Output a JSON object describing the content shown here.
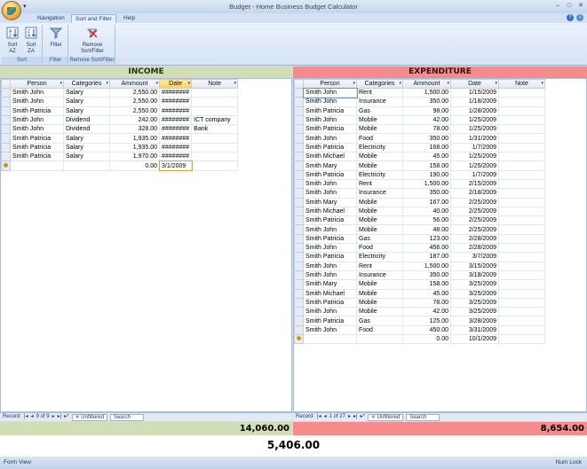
{
  "window": {
    "title": "Budget - Home Business Budget Calculator"
  },
  "ribbon": {
    "tabs": [
      {
        "label": "Navigation"
      },
      {
        "label": "Sort and Filter"
      },
      {
        "label": "Help"
      }
    ],
    "groups": {
      "sort": {
        "label": "Sort",
        "sort_az": "Sort\nAZ",
        "sort_za": "Sort\nZA"
      },
      "filter": {
        "label": "Filter",
        "filter_btn": "Filter"
      },
      "remove": {
        "label": "Remove Sort/Filter",
        "remove_btn": "Remove\nSort/Filter"
      }
    }
  },
  "income": {
    "header": "INCOME",
    "columns": [
      "Person",
      "Categories",
      "Ammount",
      "Date",
      "Note"
    ],
    "rows": [
      {
        "person": "Smith John",
        "category": "Salary",
        "amount": "2,550.00",
        "date": "########",
        "note": ""
      },
      {
        "person": "Smith John",
        "category": "Salary",
        "amount": "2,550.00",
        "date": "########",
        "note": ""
      },
      {
        "person": "Smith Patricia",
        "category": "Salary",
        "amount": "2,550.00",
        "date": "########",
        "note": ""
      },
      {
        "person": "Smith John",
        "category": "Dividend",
        "amount": "242.00",
        "date": "########",
        "note": "ICT company"
      },
      {
        "person": "Smith John",
        "category": "Dividend",
        "amount": "328.00",
        "date": "########",
        "note": "Bank"
      },
      {
        "person": "Smith Patricia",
        "category": "Salary",
        "amount": "1,935.00",
        "date": "########",
        "note": ""
      },
      {
        "person": "Smith Patricia",
        "category": "Salary",
        "amount": "1,935.00",
        "date": "########",
        "note": ""
      },
      {
        "person": "Smith Patricia",
        "category": "Salary",
        "amount": "1,970.00",
        "date": "########",
        "note": ""
      }
    ],
    "new_row": {
      "amount": "0.00",
      "date": "3/1/2009"
    },
    "nav": {
      "record_label": "Record:",
      "position": "9 of 9",
      "filter": "Unfiltered",
      "search": "Search"
    },
    "total": "14,060.00"
  },
  "expenditure": {
    "header": "EXPENDITURE",
    "columns": [
      "Person",
      "Categories",
      "Ammount",
      "Date",
      "Note"
    ],
    "rows": [
      {
        "person": "Smith John",
        "category": "Rent",
        "amount": "1,500.00",
        "date": "1/15/2009",
        "note": ""
      },
      {
        "person": "Smith John",
        "category": "Insurance",
        "amount": "350.00",
        "date": "1/18/2009",
        "note": ""
      },
      {
        "person": "Smith Patricia",
        "category": "Gas",
        "amount": "98.00",
        "date": "1/28/2009",
        "note": ""
      },
      {
        "person": "Smith John",
        "category": "Mobile",
        "amount": "42.00",
        "date": "1/25/2009",
        "note": ""
      },
      {
        "person": "Smith Patricia",
        "category": "Mobile",
        "amount": "78.00",
        "date": "1/25/2009",
        "note": ""
      },
      {
        "person": "Smith John",
        "category": "Food",
        "amount": "350.00",
        "date": "1/31/2009",
        "note": ""
      },
      {
        "person": "Smith Patricia",
        "category": "Electricity",
        "amount": "168.00",
        "date": "1/7/2009",
        "note": ""
      },
      {
        "person": "Smith Michael",
        "category": "Mobile",
        "amount": "45.00",
        "date": "1/25/2009",
        "note": ""
      },
      {
        "person": "Smith Mary",
        "category": "Mobile",
        "amount": "158.00",
        "date": "1/25/2009",
        "note": ""
      },
      {
        "person": "Smith Patricia",
        "category": "Electricity",
        "amount": "190.00",
        "date": "1/7/2009",
        "note": ""
      },
      {
        "person": "Smith John",
        "category": "Rent",
        "amount": "1,500.00",
        "date": "2/15/2009",
        "note": ""
      },
      {
        "person": "Smith John",
        "category": "Insurance",
        "amount": "350.00",
        "date": "2/18/2009",
        "note": ""
      },
      {
        "person": "Smith Mary",
        "category": "Mobile",
        "amount": "167.00",
        "date": "2/25/2009",
        "note": ""
      },
      {
        "person": "Smith Michael",
        "category": "Mobile",
        "amount": "40.00",
        "date": "2/25/2009",
        "note": ""
      },
      {
        "person": "Smith Patricia",
        "category": "Mobile",
        "amount": "56.00",
        "date": "2/25/2009",
        "note": ""
      },
      {
        "person": "Smith John",
        "category": "Mobile",
        "amount": "48.00",
        "date": "2/25/2009",
        "note": ""
      },
      {
        "person": "Smith Patricia",
        "category": "Gas",
        "amount": "123.00",
        "date": "2/28/2009",
        "note": ""
      },
      {
        "person": "Smith John",
        "category": "Food",
        "amount": "456.00",
        "date": "2/28/2009",
        "note": ""
      },
      {
        "person": "Smith Patricia",
        "category": "Electricity",
        "amount": "187.00",
        "date": "3/7/2009",
        "note": ""
      },
      {
        "person": "Smith John",
        "category": "Rent",
        "amount": "1,500.00",
        "date": "3/15/2009",
        "note": ""
      },
      {
        "person": "Smith John",
        "category": "Insurance",
        "amount": "350.00",
        "date": "3/18/2009",
        "note": ""
      },
      {
        "person": "Smith Mary",
        "category": "Mobile",
        "amount": "158.00",
        "date": "3/25/2009",
        "note": ""
      },
      {
        "person": "Smith Michael",
        "category": "Mobile",
        "amount": "45.00",
        "date": "3/25/2009",
        "note": ""
      },
      {
        "person": "Smith Patricia",
        "category": "Mobile",
        "amount": "78.00",
        "date": "3/25/2009",
        "note": ""
      },
      {
        "person": "Smith John",
        "category": "Mobile",
        "amount": "42.00",
        "date": "3/25/2009",
        "note": ""
      },
      {
        "person": "Smith Patricia",
        "category": "Gas",
        "amount": "125.00",
        "date": "3/28/2009",
        "note": ""
      },
      {
        "person": "Smith John",
        "category": "Food",
        "amount": "450.00",
        "date": "3/31/2009",
        "note": ""
      }
    ],
    "new_row": {
      "amount": "0.00",
      "date": "10/1/2009"
    },
    "nav": {
      "record_label": "Record:",
      "position": "1 of 27",
      "filter": "Unfiltered",
      "search": "Search"
    },
    "total": "8,654.00"
  },
  "net_total": "5,406.00",
  "status": {
    "left": "Form View",
    "right": "Num Lock"
  },
  "colors": {
    "income": "#d2dfb6",
    "expenditure": "#f58b8b"
  }
}
